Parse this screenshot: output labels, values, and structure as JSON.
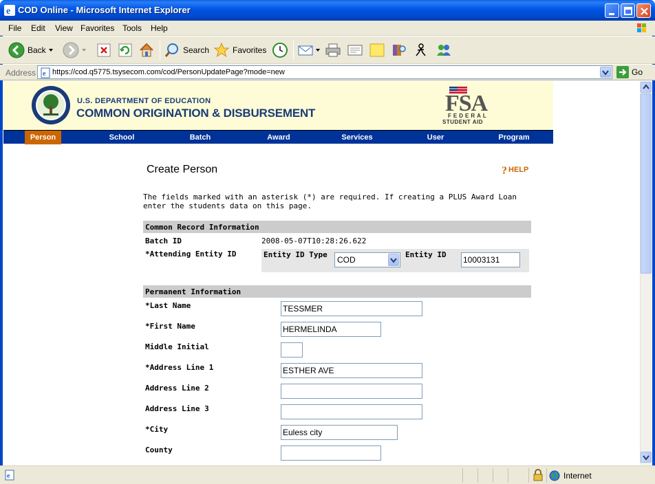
{
  "window": {
    "title": "COD Online - Microsoft Internet Explorer"
  },
  "menu": {
    "items": [
      "File",
      "Edit",
      "View",
      "Favorites",
      "Tools",
      "Help"
    ]
  },
  "toolbar": {
    "back_label": "Back",
    "search_label": "Search",
    "favorites_label": "Favorites"
  },
  "address": {
    "label": "Address",
    "url": "https://cod.q5775.tsysecom.com/cod/PersonUpdatePage?mode=new",
    "go_label": "Go"
  },
  "header": {
    "department": "U.S. DEPARTMENT OF EDUCATION",
    "title": "COMMON ORIGINATION & DISBURSEMENT",
    "fsa_big": "FSA",
    "fsa_small1": "FEDERAL",
    "fsa_small2": "STUDENT AID"
  },
  "nav": {
    "tabs": [
      "Person",
      "School",
      "Batch",
      "Award",
      "Services",
      "User",
      "Program"
    ],
    "active": "Person"
  },
  "form": {
    "title": "Create Person",
    "help_label": "HELP",
    "intro": "The fields marked with an asterisk (*) are required. If creating a PLUS Award Loan enter the students data on this page.",
    "common_section": "Common Record Information",
    "batch_id_label": "Batch ID",
    "batch_id_value": "2008-05-07T10:28:26.622",
    "attending_label": "*Attending Entity ID",
    "entity_type_label": "Entity ID Type",
    "entity_type_value": "COD",
    "entity_id_label": "Entity ID",
    "entity_id_value": "10003131",
    "permanent_section": "Permanent Information",
    "fields": {
      "last_name": {
        "label": "*Last Name",
        "value": "TESSMER"
      },
      "first_name": {
        "label": "*First Name",
        "value": "HERMELINDA"
      },
      "middle_initial": {
        "label": "Middle Initial",
        "value": ""
      },
      "address1": {
        "label": "*Address Line 1",
        "value": "ESTHER AVE"
      },
      "address2": {
        "label": "Address Line 2",
        "value": ""
      },
      "address3": {
        "label": "Address Line 3",
        "value": ""
      },
      "city": {
        "label": "*City",
        "value": "Euless city"
      },
      "county": {
        "label": "County",
        "value": ""
      }
    }
  },
  "status": {
    "zone": "Internet"
  },
  "colors": {
    "nav_bg": "#003399",
    "nav_active": "#cc6600",
    "header_bg": "#fdfcd6",
    "section_bg": "#cccccc",
    "help": "#cc6600"
  }
}
